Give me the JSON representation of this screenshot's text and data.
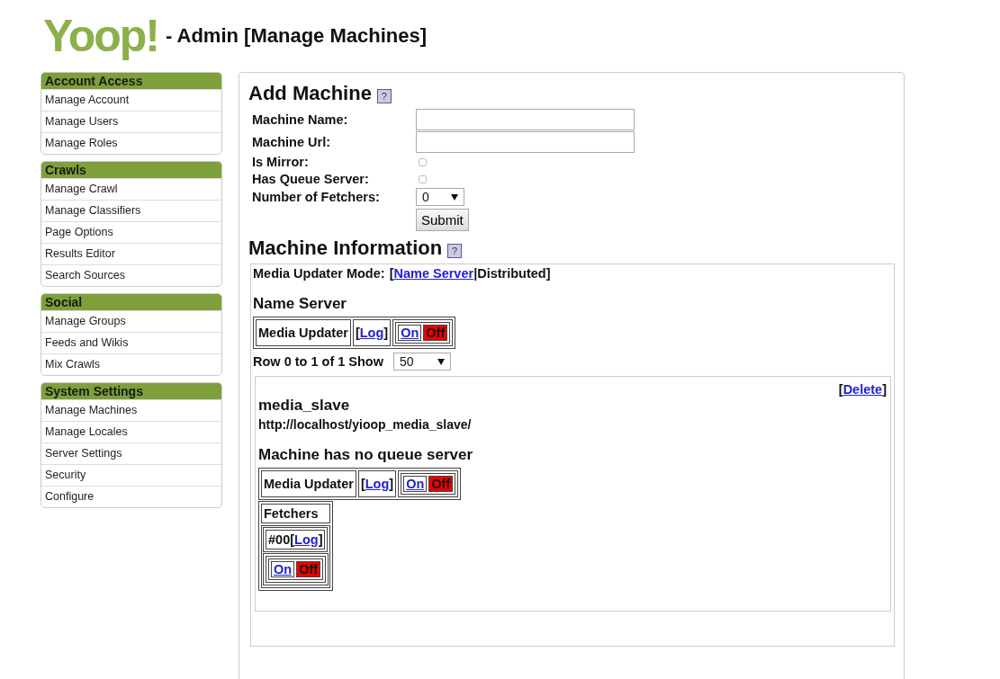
{
  "header": {
    "logo": "Yoop!",
    "title": "- Admin [Manage Machines]"
  },
  "sidebar": [
    {
      "heading": "Account Access",
      "items": [
        "Manage Account",
        "Manage Users",
        "Manage Roles"
      ]
    },
    {
      "heading": "Crawls",
      "items": [
        "Manage Crawl",
        "Manage Classifiers",
        "Page Options",
        "Results Editor",
        "Search Sources"
      ]
    },
    {
      "heading": "Social",
      "items": [
        "Manage Groups",
        "Feeds and Wikis",
        "Mix Crawls"
      ]
    },
    {
      "heading": "System Settings",
      "items": [
        "Manage Machines",
        "Manage Locales",
        "Server Settings",
        "Security",
        "Configure"
      ]
    }
  ],
  "add_machine": {
    "title": "Add Machine",
    "help": "?",
    "fields": [
      {
        "kind": "text",
        "label": "Machine Name:"
      },
      {
        "kind": "text",
        "label": "Machine Url:"
      },
      {
        "kind": "checkbox",
        "label": "Is Mirror:",
        "checked": false
      },
      {
        "kind": "checkbox",
        "label": "Has Queue Server:",
        "checked": false
      },
      {
        "kind": "select",
        "label": "Number of Fetchers:",
        "value": "0"
      }
    ],
    "submit": "Submit"
  },
  "machine_info": {
    "title": "Machine Information",
    "help": "?",
    "mode": {
      "label": "Media Updater Mode:",
      "open": "[",
      "separator": "|",
      "close": "]",
      "options": [
        {
          "label": "Name Server",
          "selected": false
        },
        {
          "label": "Distributed",
          "selected": true
        }
      ]
    },
    "name_server": {
      "heading": "Name Server",
      "processes": [
        {
          "name": "Media Updater",
          "log": {
            "open": "[",
            "label": "Log",
            "close": "]"
          },
          "on": "On",
          "off": "Off",
          "running": false
        }
      ]
    },
    "pager": {
      "label": "Row 0 to 1 of 1 Show",
      "value": "50"
    },
    "machines": [
      {
        "delete": {
          "open": "[",
          "label": "Delete",
          "close": "]"
        },
        "name": "media_slave",
        "url": "http://localhost/yioop_media_slave/",
        "queue_heading": "Machine has no queue server",
        "processes": [
          {
            "name": "Media Updater",
            "log": {
              "open": "[",
              "label": "Log",
              "close": "]"
            },
            "on": "On",
            "off": "Off",
            "running": false
          }
        ],
        "fetchers": {
          "heading": "Fetchers",
          "items": [
            {
              "id": "#00",
              "log": {
                "open": "[",
                "label": "Log",
                "close": "]"
              },
              "on": "On",
              "off": "Off",
              "running": false
            }
          ]
        }
      }
    ]
  }
}
